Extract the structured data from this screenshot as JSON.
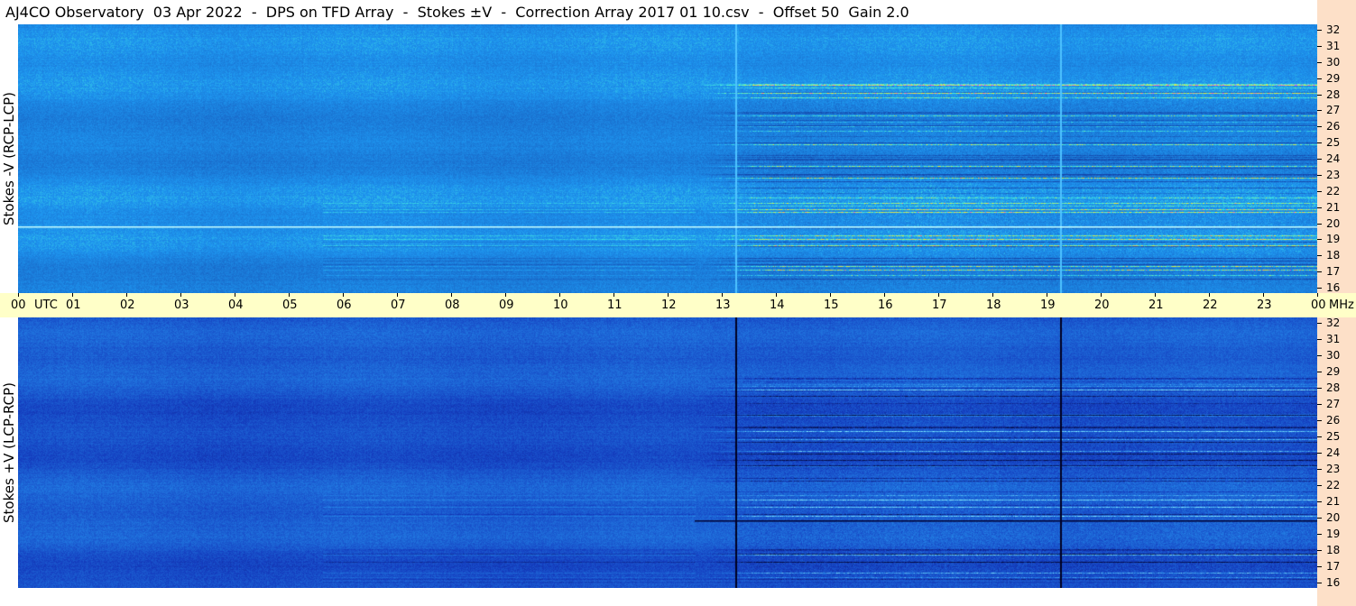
{
  "title": "AJ4CO Observatory  03 Apr 2022  -  DPS on TFD Array  -  Stokes ±V  -  Correction Array 2017 01 10.csv  -  Offset 50  Gain 2.0",
  "chart_data": [
    {
      "type": "heatmap",
      "name": "Stokes -V (RCP-LCP)",
      "ylabel": "Stokes -V (RCP-LCP)",
      "x_axis": {
        "unit": "UTC",
        "range": [
          0,
          24
        ],
        "tick_labels": [
          "00",
          "01",
          "02",
          "03",
          "04",
          "05",
          "06",
          "07",
          "08",
          "09",
          "10",
          "11",
          "12",
          "13",
          "14",
          "15",
          "16",
          "17",
          "18",
          "19",
          "20",
          "21",
          "22",
          "23",
          "00"
        ]
      },
      "y_axis": {
        "unit": "MHz",
        "range": [
          16,
          32
        ],
        "tick_labels": [
          "16",
          "17",
          "18",
          "19",
          "20",
          "21",
          "22",
          "23",
          "24",
          "25",
          "26",
          "27",
          "28",
          "29",
          "30",
          "31",
          "32"
        ]
      },
      "colormap": {
        "low": "#1a3f9a",
        "mid": "#1a90ff",
        "high": "#ff40ff"
      },
      "features": [
        {
          "kind": "vertical_line",
          "utc": 13.25,
          "color": "#4fc3ff"
        },
        {
          "kind": "vertical_line",
          "utc": 19.25,
          "color": "#4fc3ff"
        },
        {
          "kind": "activity_region",
          "utc_range": [
            12.5,
            24
          ],
          "mhz_range": [
            16.5,
            28.5
          ]
        },
        {
          "kind": "bright_line",
          "mhz": 20,
          "utc_range": [
            0,
            24
          ],
          "color": "#c8ffff"
        }
      ]
    },
    {
      "type": "heatmap",
      "name": "Stokes +V (LCP-RCP)",
      "ylabel": "Stokes +V (LCP-RCP)",
      "x_axis": {
        "unit": "UTC",
        "range": [
          0,
          24
        ]
      },
      "y_axis": {
        "unit": "MHz",
        "range": [
          16,
          32
        ],
        "tick_labels": [
          "16",
          "17",
          "18",
          "19",
          "20",
          "21",
          "22",
          "23",
          "24",
          "25",
          "26",
          "27",
          "28",
          "29",
          "30",
          "31",
          "32"
        ]
      },
      "colormap": {
        "low": "#050a40",
        "mid": "#1f5fd8",
        "high": "#7fe7ff"
      },
      "features": [
        {
          "kind": "vertical_line",
          "utc": 13.25,
          "color": "#000020"
        },
        {
          "kind": "vertical_line",
          "utc": 19.25,
          "color": "#000020"
        },
        {
          "kind": "activity_region",
          "utc_range": [
            12.5,
            24
          ],
          "mhz_range": [
            16.5,
            28.5
          ]
        },
        {
          "kind": "dark_line",
          "mhz": 20,
          "utc_range": [
            12.5,
            24
          ],
          "color": "#000030"
        }
      ]
    }
  ],
  "time_axis": {
    "utc_label": "UTC",
    "mhz_label": "MHz",
    "hours": [
      "00",
      "01",
      "02",
      "03",
      "04",
      "05",
      "06",
      "07",
      "08",
      "09",
      "10",
      "11",
      "12",
      "13",
      "14",
      "15",
      "16",
      "17",
      "18",
      "19",
      "20",
      "21",
      "22",
      "23",
      "00"
    ]
  }
}
